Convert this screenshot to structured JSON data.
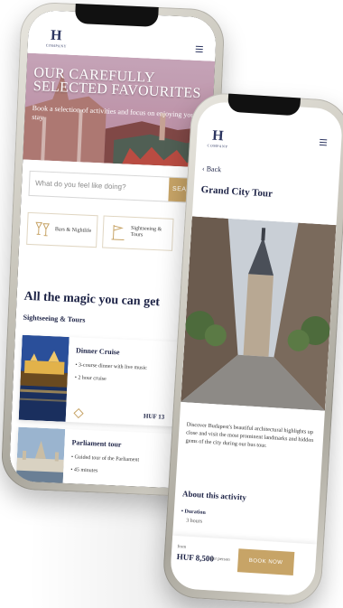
{
  "brand": {
    "logo_mark": "H",
    "logo_text": "COMPANY",
    "accent_color": "#c7a467",
    "navy_color": "#1d2346"
  },
  "home": {
    "hero_title": "OUR CAREFULLY SELECTED FAVOURITES",
    "hero_subtitle": "Book a selection of activities and focus on enjoying your stay",
    "search": {
      "placeholder": "What do you feel like doing?",
      "button_label": "SEARCH"
    },
    "categories": [
      {
        "label": "Bars & Nightlife",
        "icon": "cocktail-glasses-icon"
      },
      {
        "label": "Sightseeing & Tours",
        "icon": "flag-map-icon"
      }
    ],
    "section_title": "All the magic you can get",
    "section_subtitle": "Sightseeing & Tours",
    "tours": [
      {
        "name": "Dinner Cruise",
        "bullets": [
          "3-course dinner with live music",
          "2 hour cruise"
        ],
        "price": "HUF 13"
      },
      {
        "name": "Parliament tour",
        "bullets": [
          "Guided tour of the Parliament",
          "45 minutes"
        ]
      }
    ]
  },
  "detail": {
    "back_label": "Back",
    "title": "Grand City Tour",
    "description": "Discover Budapest's beautiful architectural highlights up close and visit the most prominent landmarks and hidden gems of the city during our bus tour.",
    "about_title": "About this activity",
    "duration_label": "Duration",
    "duration_value": "3 hours",
    "from_label": "from",
    "price": "HUF 8,500",
    "per_label": "per person",
    "book_label": "BOOK NOW"
  }
}
